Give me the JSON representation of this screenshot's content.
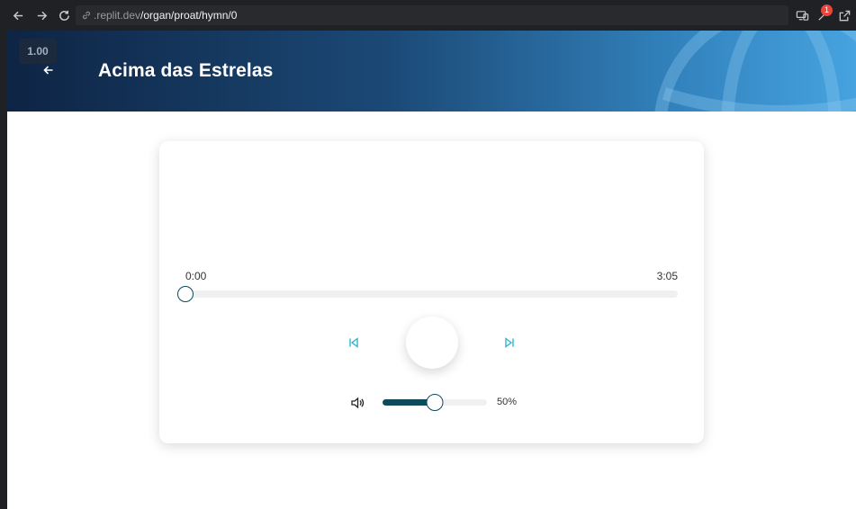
{
  "browser": {
    "url_host": ".replit.dev",
    "url_path": "/organ/proat/hymn/0",
    "badge_count": "1"
  },
  "header": {
    "playback_speed": "1.00",
    "title": "Acima das Estrelas"
  },
  "player": {
    "current_time": "0:00",
    "total_time": "3:05",
    "progress_fraction": 0.0,
    "volume_label": "50%",
    "volume_fraction": 0.5
  },
  "colors": {
    "accent": "#0c4a5c",
    "control_icon": "#2fb6cc",
    "header_gradient_start": "#0e2444",
    "header_gradient_end": "#46a3df"
  },
  "icons": {
    "back": "arrow-left-icon",
    "previous": "skip-previous-icon",
    "next": "skip-next-icon",
    "volume": "volume-icon"
  }
}
